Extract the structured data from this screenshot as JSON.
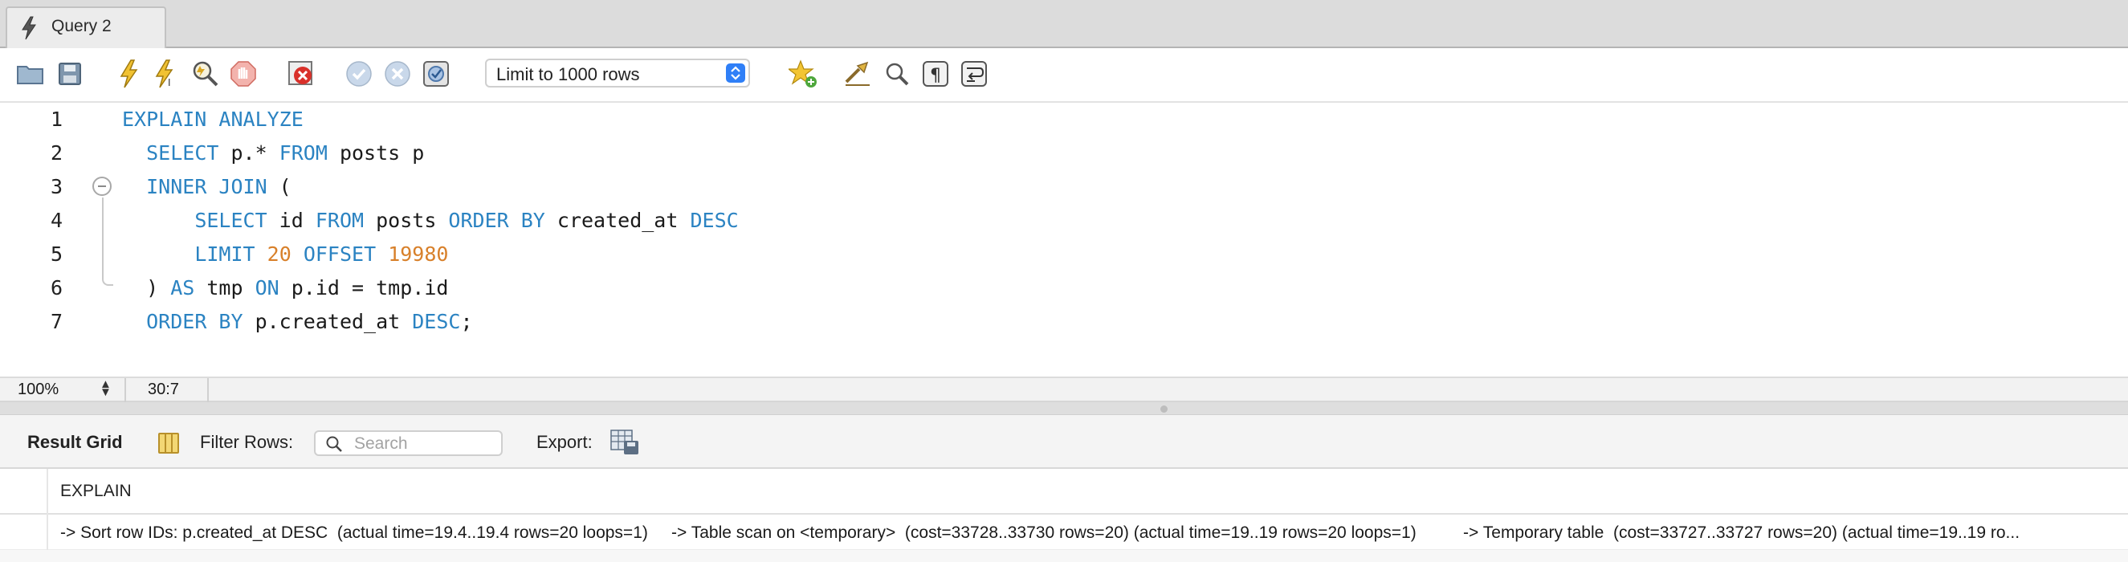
{
  "tab": {
    "title": "Query 2"
  },
  "toolbar": {
    "limit_select": "Limit to 1000 rows",
    "icons": [
      "open-folder-icon",
      "save-icon",
      "execute-icon",
      "execute-current-icon",
      "explain-icon",
      "stop-icon",
      "toggle-error-icon",
      "commit-icon",
      "rollback-icon",
      "autocommit-icon",
      "bookmark-icon",
      "beautify-icon",
      "find-icon",
      "invisible-chars-icon",
      "wrap-icon"
    ]
  },
  "editor": {
    "line_numbers": [
      "1",
      "2",
      "3",
      "4",
      "5",
      "6",
      "7"
    ],
    "lines": [
      [
        {
          "t": "EXPLAIN ANALYZE",
          "c": "kw"
        }
      ],
      [
        {
          "t": "  "
        },
        {
          "t": "SELECT",
          "c": "kw"
        },
        {
          "t": " p.* "
        },
        {
          "t": "FROM",
          "c": "kw"
        },
        {
          "t": " posts p"
        }
      ],
      [
        {
          "t": "  "
        },
        {
          "t": "INNER JOIN",
          "c": "kw"
        },
        {
          "t": " ("
        }
      ],
      [
        {
          "t": "      "
        },
        {
          "t": "SELECT",
          "c": "kw"
        },
        {
          "t": " id "
        },
        {
          "t": "FROM",
          "c": "kw"
        },
        {
          "t": " posts "
        },
        {
          "t": "ORDER BY",
          "c": "kw"
        },
        {
          "t": " created_at "
        },
        {
          "t": "DESC",
          "c": "kw"
        }
      ],
      [
        {
          "t": "      "
        },
        {
          "t": "LIMIT",
          "c": "kw"
        },
        {
          "t": " "
        },
        {
          "t": "20",
          "c": "num"
        },
        {
          "t": " "
        },
        {
          "t": "OFFSET",
          "c": "kw"
        },
        {
          "t": " "
        },
        {
          "t": "19980",
          "c": "num"
        }
      ],
      [
        {
          "t": "  ) "
        },
        {
          "t": "AS",
          "c": "kw"
        },
        {
          "t": " tmp "
        },
        {
          "t": "ON",
          "c": "kw"
        },
        {
          "t": " p.id = tmp.id"
        }
      ],
      [
        {
          "t": "  "
        },
        {
          "t": "ORDER BY",
          "c": "kw"
        },
        {
          "t": " p.created_at "
        },
        {
          "t": "DESC",
          "c": "kw"
        },
        {
          "t": ";"
        }
      ]
    ]
  },
  "status": {
    "zoom": "100%",
    "cursor": "30:7"
  },
  "result_toolbar": {
    "result_grid_label": "Result Grid",
    "filter_label": "Filter Rows:",
    "search_placeholder": "Search",
    "export_label": "Export:"
  },
  "grid": {
    "column": "EXPLAIN",
    "row_value": "-> Sort row IDs: p.created_at DESC  (actual time=19.4..19.4 rows=20 loops=1)     -> Table scan on <temporary>  (cost=33728..33730 rows=20) (actual time=19..19 rows=20 loops=1)          -> Temporary table  (cost=33727..33727 rows=20) (actual time=19..19 ro..."
  },
  "colors": {
    "keyword": "#2b83c2",
    "number": "#d8802a",
    "select_accent": "#2f7ff7"
  }
}
